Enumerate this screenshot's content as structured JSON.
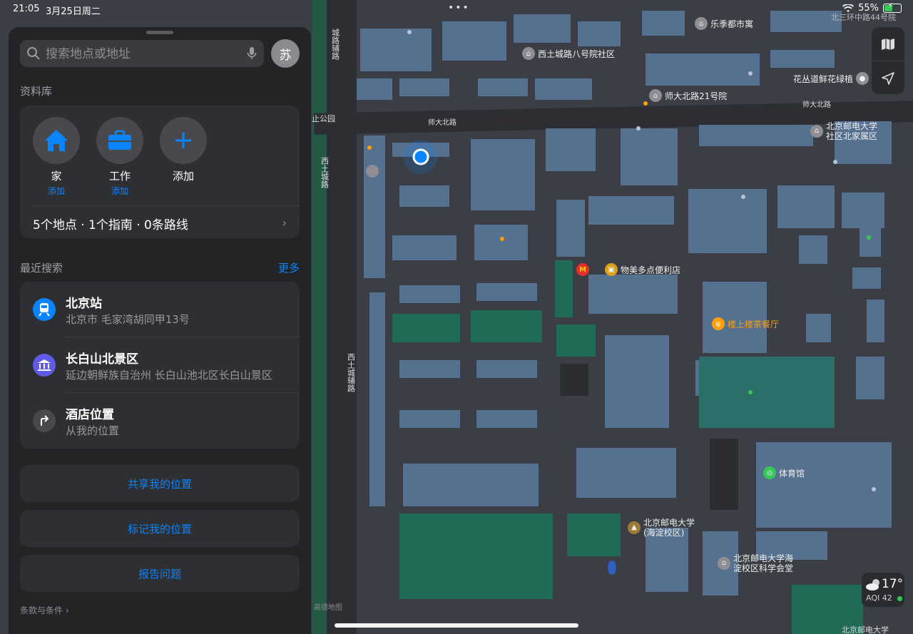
{
  "status_bar": {
    "time": "21:05",
    "date": "3月25日周二",
    "battery": "55%",
    "battery_level": 0.55
  },
  "search": {
    "placeholder": "搜索地点或地址"
  },
  "avatar": {
    "initial": "苏"
  },
  "library": {
    "title": "资料库",
    "favorites": [
      {
        "name": "家",
        "sub": "添加",
        "icon": "house-icon"
      },
      {
        "name": "工作",
        "sub": "添加",
        "icon": "briefcase-icon"
      },
      {
        "name": "添加",
        "sub": "",
        "icon": "plus-icon"
      }
    ],
    "summary": "5个地点 · 1个指南 · 0条路线"
  },
  "recents": {
    "title": "最近搜索",
    "more": "更多",
    "items": [
      {
        "title": "北京站",
        "subtitle": "北京市 毛家湾胡同甲13号",
        "icon": "train-icon",
        "color": "#0a84ff"
      },
      {
        "title": "长白山北景区",
        "subtitle": "延边朝鲜族自治州 长白山池北区长白山景区",
        "icon": "landmark-icon",
        "color": "#5e5ce6"
      },
      {
        "title": "酒店位置",
        "subtitle": "从我的位置",
        "icon": "turn-arrow-icon",
        "color": "#48494d"
      }
    ]
  },
  "actions": {
    "share": "共享我的位置",
    "mark": "标记我的位置",
    "report": "报告问题"
  },
  "terms": "条款与条件 ›",
  "weather": {
    "temp": "17°",
    "aqi": "AQI 42"
  },
  "map": {
    "roads": {
      "shidabeilu_top": "师大北路",
      "shidabeilu_right": "师大北路",
      "xitucheng_fulu_top": "城路辅路",
      "xituchenglu": "西土城路",
      "xitucheng_fulu": "西土城辅路",
      "park": "止公园"
    },
    "pois": [
      {
        "name": "乐季都市寓",
        "icon": "building-icon"
      },
      {
        "name": "西土城路八号院社区",
        "icon": "building-icon"
      },
      {
        "name": "花丛道鲜花绿植",
        "icon": "flower-icon"
      },
      {
        "name": "师大北路21号院",
        "icon": "building-icon"
      },
      {
        "name": "北京邮电大学\n社区北家属区",
        "icon": "building-icon"
      },
      {
        "name": "物美多点便利店",
        "icon": "store-icon"
      },
      {
        "name": "楼上楼茶餐厅",
        "icon": "restaurant-icon"
      },
      {
        "name": "体育馆",
        "icon": "stadium-icon"
      },
      {
        "name": "北京邮电大学\n(海淀校区)",
        "icon": "school-icon"
      },
      {
        "name": "北京邮电大学海\n淀校区科学会堂",
        "icon": "building-icon"
      }
    ],
    "top_right_label": "北三环中路44号院",
    "bottom_right_label": "北京邮电大学",
    "attribution": "高德地图"
  }
}
